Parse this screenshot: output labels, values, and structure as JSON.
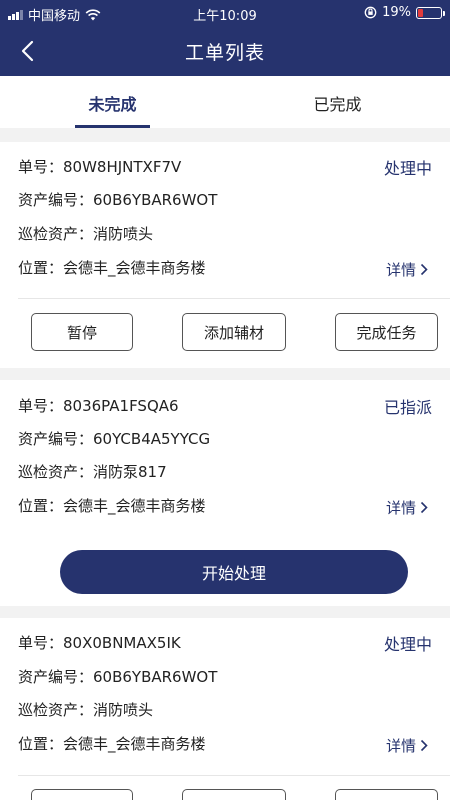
{
  "status_bar": {
    "carrier": "中国移动",
    "time": "上午10:09",
    "battery": "19%"
  },
  "nav": {
    "title": "工单列表",
    "back_icon": "chevron-left-icon"
  },
  "tabs": [
    {
      "label": "未完成",
      "active": true
    },
    {
      "label": "已完成",
      "active": false
    }
  ],
  "orders": [
    {
      "number": "单号：80W8HJNTXF7V",
      "status": "处理中",
      "asset_code": "资产编号：60B6YBAR6WOT",
      "asset": "巡检资产：消防喷头",
      "location": "位置：会德丰_会德丰商务楼",
      "detail": "详情",
      "actions": [
        "暂停",
        "添加辅材",
        "完成任务"
      ]
    },
    {
      "number": "单号：8036PA1FSQA6",
      "status": "已指派",
      "asset_code": "资产编号：60YCB4A5YYCG",
      "asset": "巡检资产：消防泵817",
      "location": "位置：会德丰_会德丰商务楼",
      "detail": "详情",
      "primary_action": "开始处理"
    },
    {
      "number": "单号：80X0BNMAX5IK",
      "status": "处理中",
      "asset_code": "资产编号：60B6YBAR6WOT",
      "asset": "巡检资产：消防喷头",
      "location": "位置：会德丰_会德丰商务楼",
      "detail": "详情"
    }
  ],
  "colors": {
    "primary": "#26336e",
    "background": "#f2f2f2",
    "battery_low": "#e23b3b"
  }
}
